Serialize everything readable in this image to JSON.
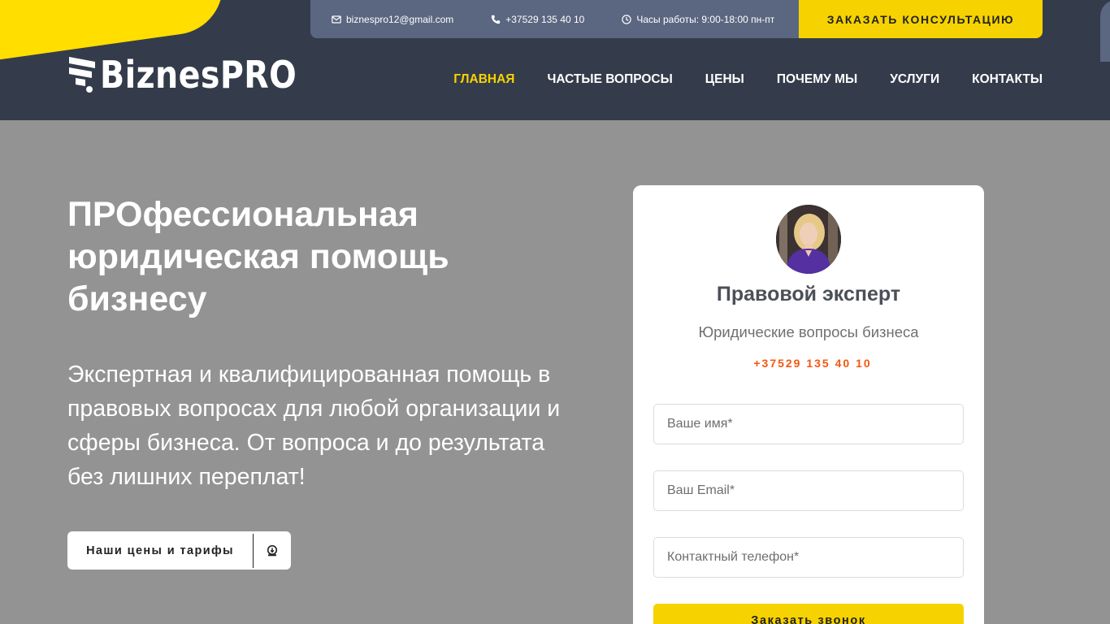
{
  "topbar": {
    "email": "biznespro12@gmail.com",
    "phone": "+37529 135 40 10",
    "hours": "Часы работы: 9:00-18:00 пн-пт",
    "cta": "ЗАКАЗАТЬ КОНСУЛЬТАЦИЮ"
  },
  "logo": {
    "text": "BiznesPRO"
  },
  "nav": [
    {
      "label": "ГЛАВНАЯ",
      "active": true
    },
    {
      "label": "ЧАСТЫЕ ВОПРОСЫ"
    },
    {
      "label": "ЦЕНЫ"
    },
    {
      "label": "ПОЧЕМУ МЫ"
    },
    {
      "label": "УСЛУГИ"
    },
    {
      "label": "КОНТАКТЫ"
    }
  ],
  "hero": {
    "title": "ПРОфессиональная юридическая помощь бизнесу",
    "subtitle": "Экспертная и квалифицированная помощь в правовых вопросах для любой организации и сферы бизнеса. От вопроса и до результата без лишних переплат!",
    "button": "Наши цены и тарифы"
  },
  "form": {
    "title": "Правовой эксперт",
    "subtitle": "Юридические вопросы бизнеса",
    "phone": "+37529 135 40 10",
    "name_placeholder": "Ваше имя*",
    "email_placeholder": "Ваш Email*",
    "tel_placeholder": "Контактный телефон*",
    "submit": "Заказать звонок"
  },
  "colors": {
    "header_bg": "#343c4b",
    "topbar_bg": "#5b6781",
    "accent_yellow": "#f6d300",
    "hero_bg": "#939393",
    "phone_orange": "#f3570f"
  },
  "icons": {
    "email": "envelope-icon",
    "phone": "phone-icon",
    "hours": "clock-icon",
    "price_button": "coin-icon"
  }
}
